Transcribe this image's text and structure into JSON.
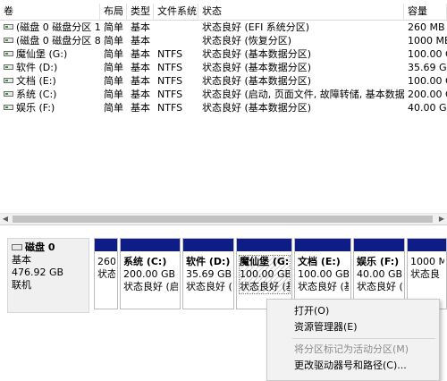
{
  "columns": [
    "卷",
    "布局",
    "类型",
    "文件系统",
    "状态",
    "容量"
  ],
  "volumes": [
    {
      "name": "(磁盘 0 磁盘分区 1)",
      "layout": "简单",
      "type": "基本",
      "fs": "",
      "status": "状态良好 (EFI 系统分区)",
      "capacity": "260 MB"
    },
    {
      "name": "(磁盘 0 磁盘分区 8)",
      "layout": "简单",
      "type": "基本",
      "fs": "",
      "status": "状态良好 (恢复分区)",
      "capacity": "1000 MB"
    },
    {
      "name": "魔仙堡 (G:)",
      "layout": "简单",
      "type": "基本",
      "fs": "NTFS",
      "status": "状态良好 (基本数据分区)",
      "capacity": "100.00 G"
    },
    {
      "name": "软件 (D:)",
      "layout": "简单",
      "type": "基本",
      "fs": "NTFS",
      "status": "状态良好 (基本数据分区)",
      "capacity": "35.69 GB"
    },
    {
      "name": "文档 (E:)",
      "layout": "简单",
      "type": "基本",
      "fs": "NTFS",
      "status": "状态良好 (基本数据分区)",
      "capacity": "100.00 G"
    },
    {
      "name": "系统 (C:)",
      "layout": "简单",
      "type": "基本",
      "fs": "NTFS",
      "status": "状态良好 (启动, 页面文件, 故障转储, 基本数据分区)",
      "capacity": "200.00 G"
    },
    {
      "name": "娱乐 (F:)",
      "layout": "简单",
      "type": "基本",
      "fs": "NTFS",
      "status": "状态良好 (基本数据分区)",
      "capacity": "40.00 GB"
    }
  ],
  "disk": {
    "name": "磁盘 0",
    "kind": "基本",
    "size": "476.92 GB",
    "state": "联机"
  },
  "partitions": [
    {
      "name": "",
      "size": "260",
      "status": "状态"
    },
    {
      "name": "系统 (C:)",
      "size": "200.00 GB N",
      "status": "状态良好 (启"
    },
    {
      "name": "软件 (D:)",
      "size": "35.69 GB N",
      "status": "状态良好 (基"
    },
    {
      "name": "魔仙堡 (G:)",
      "size": "100.00 GB",
      "status": "状态良好 (基"
    },
    {
      "name": "文档 (E:)",
      "size": "100.00 GB N",
      "status": "状态良好 (基"
    },
    {
      "name": "娱乐 (F:)",
      "size": "40.00 GB N",
      "status": "状态良好 (基"
    },
    {
      "name": "",
      "size": "1000 M",
      "status": "状态良"
    }
  ],
  "context_menu": {
    "open": "打开(O)",
    "explorer": "资源管理器(E)",
    "mark_active": "将分区标记为活动分区(M)",
    "change_letter": "更改驱动器号和路径(C)..."
  },
  "colors": {
    "partition_bar": "#0e1c87",
    "menu_bg": "#f2f2f2"
  }
}
